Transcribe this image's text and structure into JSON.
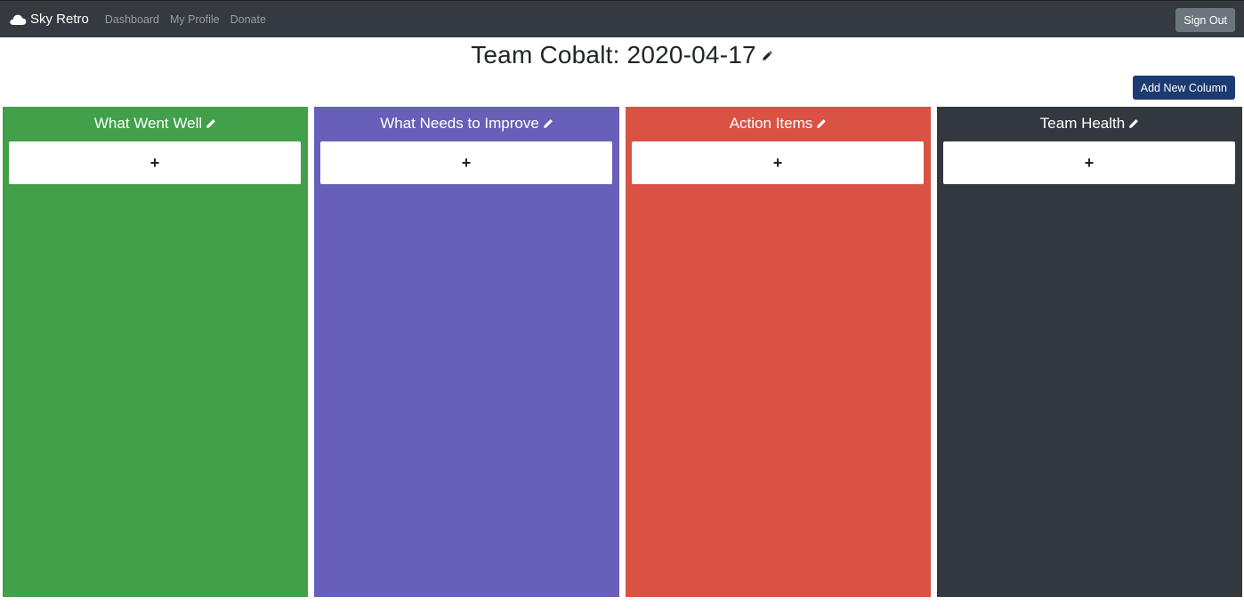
{
  "navbar": {
    "brand": "Sky Retro",
    "brand_icon": "cloud-icon",
    "links": [
      "Dashboard",
      "My Profile",
      "Donate"
    ],
    "sign_out": "Sign Out"
  },
  "board": {
    "title": "Team Cobalt: 2020-04-17",
    "add_column": "Add New Column"
  },
  "columns": [
    {
      "title": "What Went Well",
      "color": "#42a04b",
      "add_label": "+"
    },
    {
      "title": "What Needs to Improve",
      "color": "#685fb9",
      "add_label": "+"
    },
    {
      "title": "Action Items",
      "color": "#d95244",
      "add_label": "+"
    },
    {
      "title": "Team Health",
      "color": "#33383f",
      "add_label": "+"
    }
  ],
  "colors": {
    "navbar": "#343a40",
    "sign_out_bg": "#6c757d",
    "add_column_bg": "#1c3b70"
  }
}
